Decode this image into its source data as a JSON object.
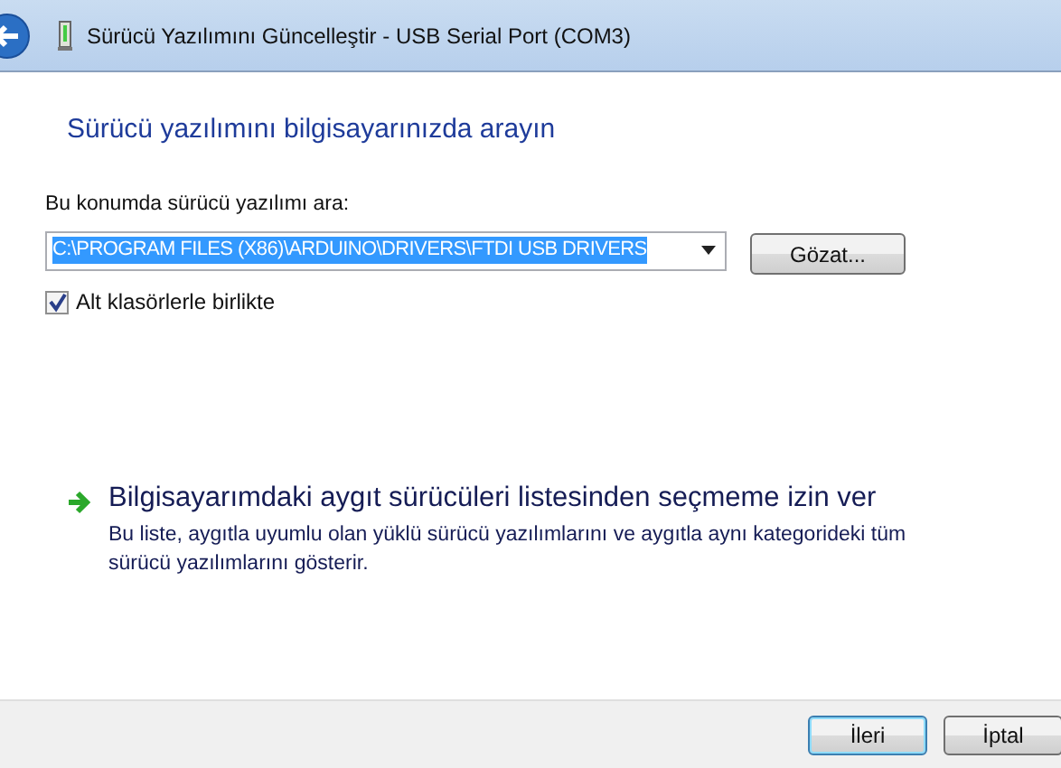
{
  "window": {
    "title": "Sürücü Yazılımını Güncelleştir - USB Serial Port (COM3)"
  },
  "heading": "Sürücü yazılımını bilgisayarınızda arayın",
  "location": {
    "label": "Bu konumda sürücü yazılımı ara:",
    "value": "C:\\PROGRAM FILES (X86)\\ARDUINO\\DRIVERS\\FTDI USB DRIVERS",
    "selected": true,
    "browse_button": "Gözat..."
  },
  "include_subfolders": {
    "label": "Alt klasörlerle birlikte",
    "checked": true
  },
  "pick_option": {
    "title": "Bilgisayarımdaki aygıt sürücüleri listesinden seçmeme izin ver",
    "description": "Bu liste, aygıtla uyumlu olan yüklü sürücü yazılımlarını ve aygıtla aynı kategorideki tüm sürücü yazılımlarını gösterir."
  },
  "buttons": [
    {
      "label": "İleri",
      "default": true
    },
    {
      "label": "İptal",
      "default": false
    }
  ]
}
